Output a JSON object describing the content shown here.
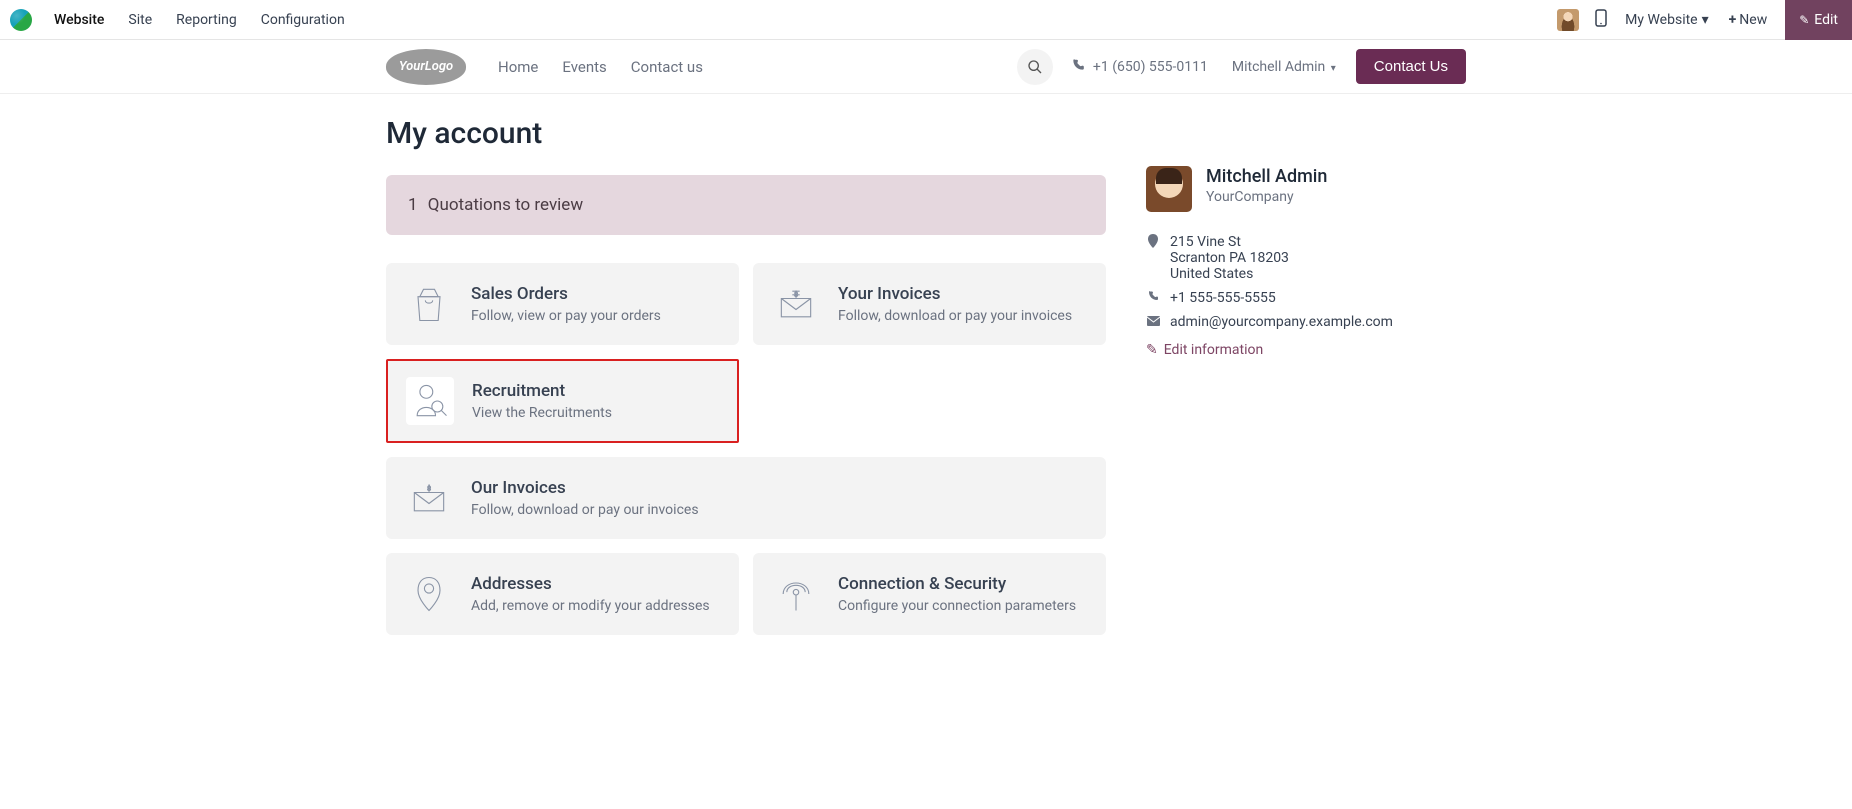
{
  "topbar": {
    "app": "Website",
    "menu": [
      "Site",
      "Reporting",
      "Configuration"
    ],
    "website_selector": "My Website",
    "new_label": "New",
    "edit_label": "Edit"
  },
  "header": {
    "logo_text": "YourLogo",
    "nav": [
      "Home",
      "Events",
      "Contact us"
    ],
    "phone": "+1 (650) 555-0111",
    "user": "Mitchell Admin",
    "contact_btn": "Contact Us"
  },
  "page": {
    "title": "My account",
    "banner_count": "1",
    "banner_text": "Quotations to review",
    "cards": {
      "sales_orders": {
        "title": "Sales Orders",
        "sub": "Follow, view or pay your orders"
      },
      "your_invoices": {
        "title": "Your Invoices",
        "sub": "Follow, download or pay your invoices"
      },
      "recruitment": {
        "title": "Recruitment",
        "sub": "View the Recruitments"
      },
      "our_invoices": {
        "title": "Our Invoices",
        "sub": "Follow, download or pay our invoices"
      },
      "addresses": {
        "title": "Addresses",
        "sub": "Add, remove or modify your addresses"
      },
      "security": {
        "title": "Connection & Security",
        "sub": "Configure your connection parameters"
      }
    }
  },
  "profile": {
    "name": "Mitchell Admin",
    "company": "YourCompany",
    "addr_line1": "215 Vine St",
    "addr_line2": "Scranton PA 18203",
    "addr_line3": "United States",
    "phone": "+1 555-555-5555",
    "email": "admin@yourcompany.example.com",
    "edit_label": "Edit information"
  }
}
